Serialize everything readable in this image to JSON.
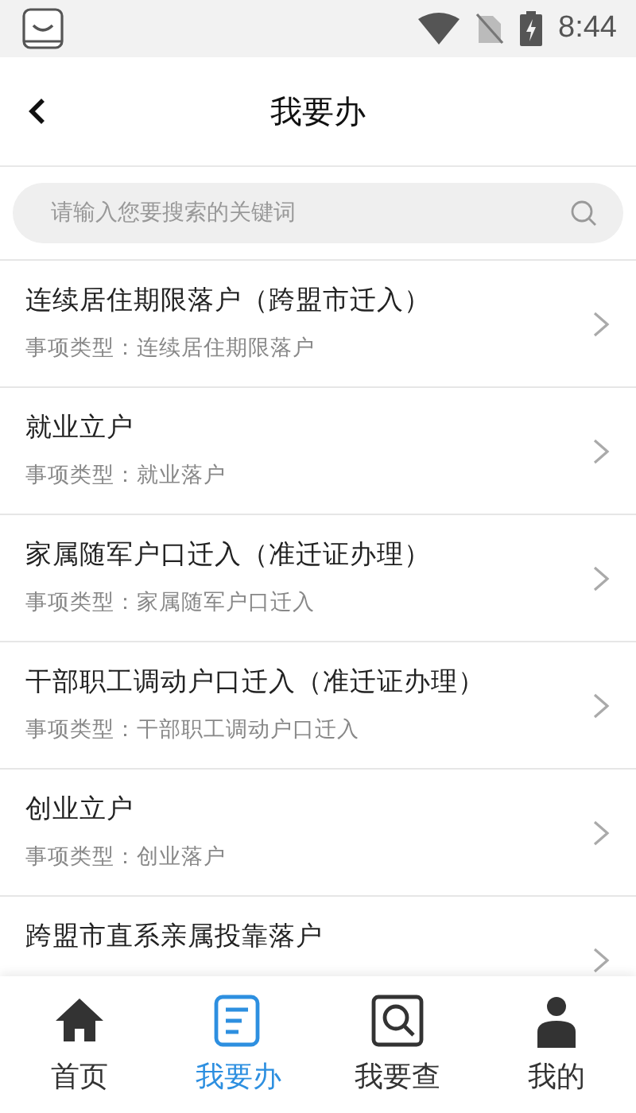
{
  "status_bar": {
    "time": "8:44"
  },
  "header": {
    "title": "我要办"
  },
  "search": {
    "placeholder": "请输入您要搜索的关键词"
  },
  "items": [
    {
      "title": "连续居住期限落户（跨盟市迁入）",
      "subtitle": "事项类型：连续居住期限落户"
    },
    {
      "title": "就业立户",
      "subtitle": "事项类型：就业落户"
    },
    {
      "title": "家属随军户口迁入（准迁证办理）",
      "subtitle": "事项类型：家属随军户口迁入"
    },
    {
      "title": "干部职工调动户口迁入（准迁证办理）",
      "subtitle": "事项类型：干部职工调动户口迁入"
    },
    {
      "title": "创业立户",
      "subtitle": "事项类型：创业落户"
    },
    {
      "title": "跨盟市直系亲属投靠落户"
    }
  ],
  "tabs": [
    {
      "label": "首页",
      "kind": "home",
      "selected": false
    },
    {
      "label": "我要办",
      "kind": "doc",
      "selected": true
    },
    {
      "label": "我要查",
      "kind": "search",
      "selected": false
    },
    {
      "label": "我的",
      "kind": "user",
      "selected": false
    }
  ]
}
